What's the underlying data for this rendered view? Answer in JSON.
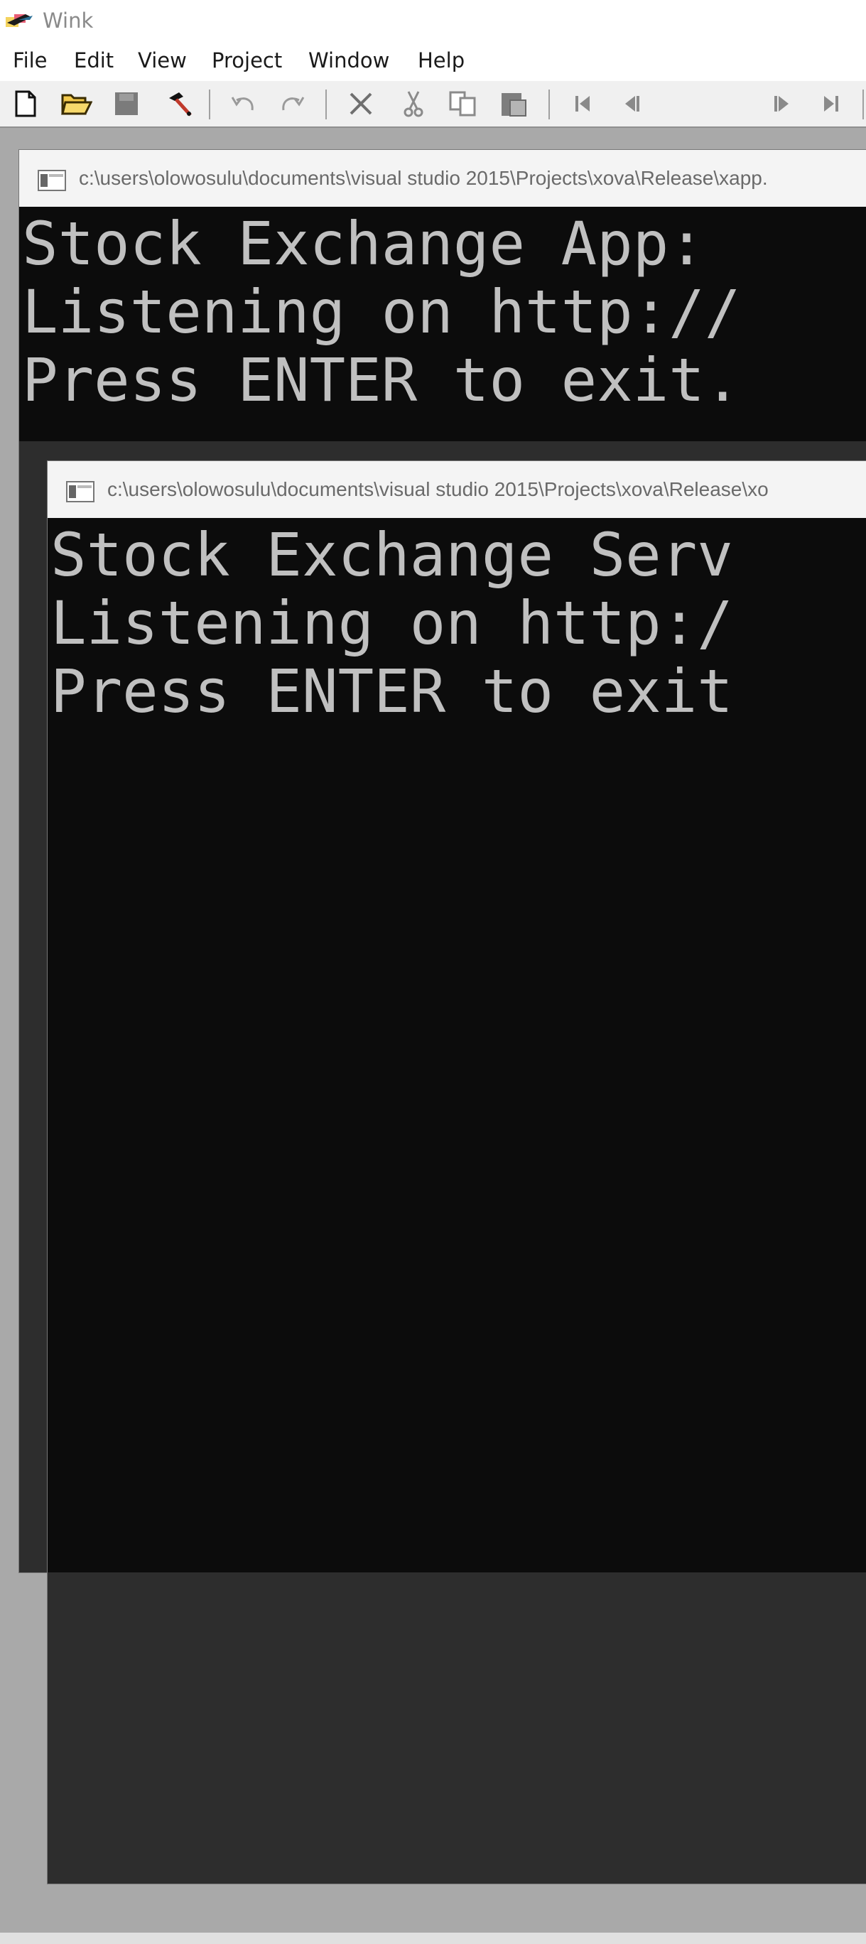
{
  "window": {
    "title": "Wink"
  },
  "menubar": {
    "items": [
      {
        "label": "File"
      },
      {
        "label": "Edit"
      },
      {
        "label": "View"
      },
      {
        "label": "Project"
      },
      {
        "label": "Window"
      },
      {
        "label": "Help"
      }
    ]
  },
  "toolbar": {
    "buttons": [
      {
        "icon": "new-file-icon"
      },
      {
        "icon": "open-folder-icon"
      },
      {
        "icon": "save-icon"
      },
      {
        "icon": "render-hammer-icon"
      },
      {
        "icon": "undo-icon"
      },
      {
        "icon": "redo-icon"
      },
      {
        "icon": "delete-icon"
      },
      {
        "icon": "cut-icon"
      },
      {
        "icon": "copy-icon"
      },
      {
        "icon": "paste-icon"
      },
      {
        "icon": "first-frame-icon"
      },
      {
        "icon": "previous-frame-icon"
      },
      {
        "icon": "next-frame-icon"
      },
      {
        "icon": "last-frame-icon"
      }
    ]
  },
  "console_back": {
    "title_path": "c:\\users\\olowosulu\\documents\\visual studio 2015\\Projects\\xova\\Release\\xapp.",
    "lines": [
      "Stock Exchange App:",
      "Listening on http://",
      "Press ENTER to exit."
    ]
  },
  "console_front": {
    "title_path": "c:\\users\\olowosulu\\documents\\visual studio 2015\\Projects\\xova\\Release\\xo",
    "lines": [
      "Stock Exchange Serv",
      "Listening on http:/",
      "Press ENTER to exit"
    ]
  },
  "colors": {
    "console_background": "#0c0c0c",
    "console_text": "#c0c0c0",
    "console_frame": "#2d2d2d",
    "workspace": "#a9a9a9"
  }
}
